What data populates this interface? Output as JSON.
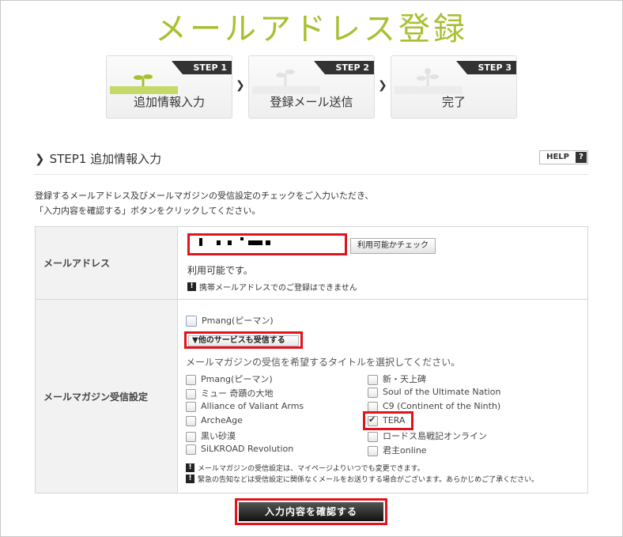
{
  "page": {
    "title": "メールアドレス登録"
  },
  "steps": [
    {
      "tag": "STEP 1",
      "label": "追加情報入力",
      "active": true
    },
    {
      "tag": "STEP 2",
      "label": "登録メール送信",
      "active": false
    },
    {
      "tag": "STEP 3",
      "label": "完了",
      "active": false
    }
  ],
  "section": {
    "title": "STEP1 追加情報入力",
    "help_label": "HELP",
    "help_icon": "?"
  },
  "intro": {
    "line1": "登録するメールアドレス及びメールマガジンの受信設定のチェックをご入力いただき、",
    "line2": "「入力内容を確認する」ボタンをクリックしてください。"
  },
  "email": {
    "label": "メールアドレス",
    "value": "",
    "check_button": "利用可能かチェック",
    "status": "利用可能です。",
    "note": "携帯メールアドレスでのご登録はできません"
  },
  "magazine": {
    "label": "メールマガジン受信設定",
    "pmang_option": "Pmang(ピーマン)",
    "toggle_label": "▼他のサービスも受信する",
    "instruction": "メールマガジンの受信を希望するタイトルを選択してください。",
    "options_left": [
      {
        "label": "Pmang(ピーマン)",
        "checked": false
      },
      {
        "label": "ミュー 奇蹟の大地",
        "checked": false
      },
      {
        "label": "Alliance of Valiant Arms",
        "checked": false
      },
      {
        "label": "ArcheAge",
        "checked": false
      },
      {
        "label": "黒い砂漠",
        "checked": false
      },
      {
        "label": "SiLKROAD Revolution",
        "checked": false
      }
    ],
    "options_right": [
      {
        "label": "新・天上碑",
        "checked": false
      },
      {
        "label": "Soul of the Ultimate Nation",
        "checked": false
      },
      {
        "label": "C9 (Continent of the Ninth)",
        "checked": false
      },
      {
        "label": "TERA",
        "checked": true
      },
      {
        "label": "ロードス島戦記オンライン",
        "checked": false
      },
      {
        "label": "君主online",
        "checked": false
      }
    ],
    "note1": "メールマガジンの受信設定は、マイページよりいつでも変更できます。",
    "note2": "緊急の告知などは受信設定に関係なくメールをお送りする場合がございます。あらかじめご了承ください。"
  },
  "submit": {
    "label": "入力内容を確認する"
  },
  "colors": {
    "title": "#a8c030",
    "highlight": "#e0141c"
  }
}
